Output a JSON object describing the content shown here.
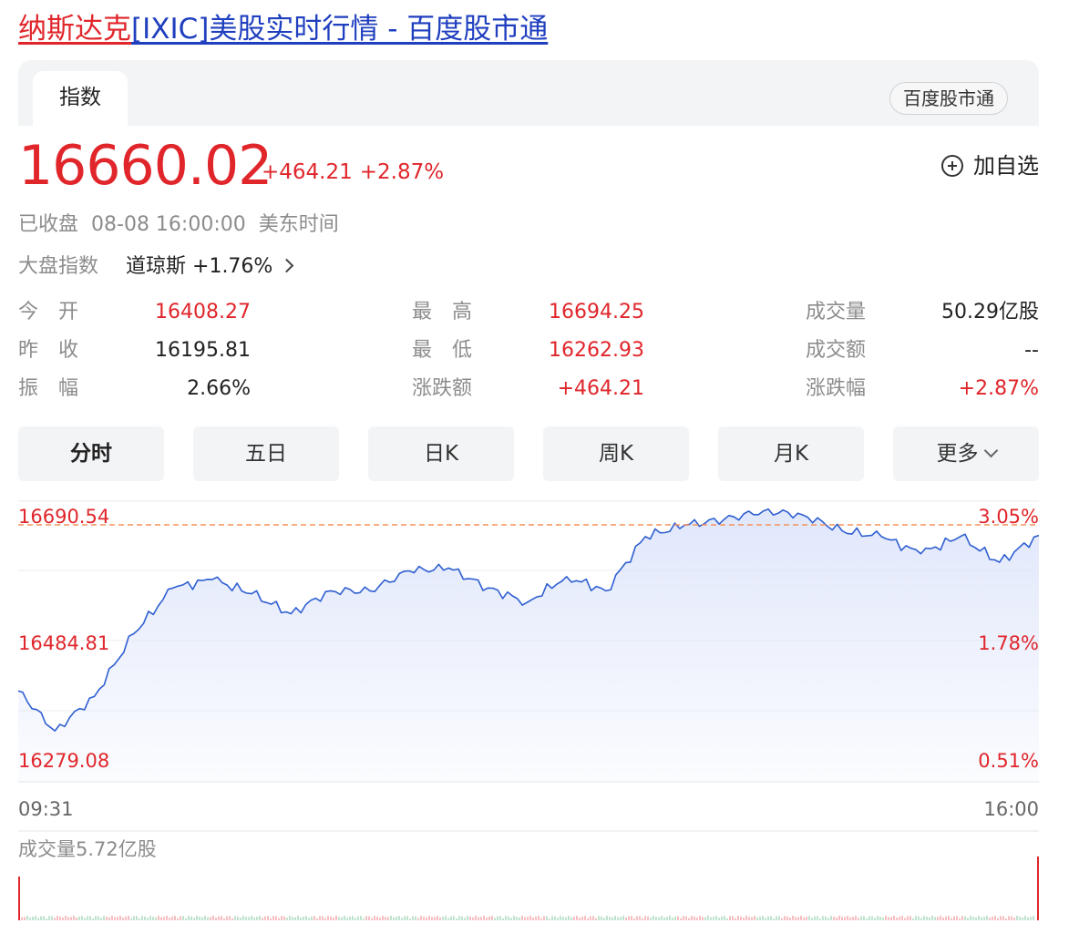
{
  "page_link": {
    "name_part": "纳斯达克",
    "rest_part": "[IXIC]美股实时行情 - 百度股市通"
  },
  "tabs": {
    "active": "指数",
    "source": "百度股市通"
  },
  "quote": {
    "price": "16660.02",
    "change": "+464.21",
    "change_pct": "+2.87%",
    "watchlist_label": "加自选"
  },
  "status": {
    "state": "已收盘",
    "time": "08-08 16:00:00",
    "timezone": "美东时间"
  },
  "market_index": {
    "label": "大盘指数",
    "value": "道琼斯 +1.76%"
  },
  "stats": [
    [
      {
        "label": "今　开",
        "value": "16408.27",
        "color": "#e0262b"
      },
      {
        "label": "最　高",
        "value": "16694.25",
        "color": "#e0262b"
      },
      {
        "label": "成交量",
        "value": "50.29亿股",
        "color": "#222222"
      }
    ],
    [
      {
        "label": "昨　收",
        "value": "16195.81",
        "color": "#222222"
      },
      {
        "label": "最　低",
        "value": "16262.93",
        "color": "#e0262b"
      },
      {
        "label": "成交额",
        "value": "--",
        "color": "#222222"
      }
    ],
    [
      {
        "label": "振　幅",
        "value": "2.66%",
        "color": "#222222"
      },
      {
        "label": "涨跌额",
        "value": "+464.21",
        "color": "#e0262b"
      },
      {
        "label": "涨跌幅",
        "value": "+2.87%",
        "color": "#e0262b"
      }
    ]
  ],
  "periods": [
    "分时",
    "五日",
    "日K",
    "周K",
    "月K",
    "更多"
  ],
  "active_period": "分时",
  "chart_data": {
    "type": "area",
    "y_labels_left": [
      "16690.54",
      "16484.81",
      "16279.08"
    ],
    "y_labels_right": [
      "3.05%",
      "1.78%",
      "0.51%"
    ],
    "x_labels": [
      "09:31",
      "16:00"
    ],
    "x_start": "09:31",
    "x_end": "16:00",
    "ylim": [
      16279.08,
      16690.54
    ],
    "reference_line": 16690.54,
    "x": [
      "09:31",
      "09:45",
      "10:00",
      "10:15",
      "10:30",
      "10:45",
      "11:00",
      "11:15",
      "11:30",
      "11:45",
      "12:00",
      "12:15",
      "12:30",
      "12:45",
      "13:00",
      "13:15",
      "13:30",
      "13:45",
      "14:00",
      "14:15",
      "14:30",
      "14:45",
      "15:00",
      "15:15",
      "15:30",
      "15:45",
      "16:00"
    ],
    "values": [
      16400,
      16330,
      16390,
      16500,
      16580,
      16595,
      16570,
      16535,
      16575,
      16575,
      16610,
      16615,
      16580,
      16555,
      16600,
      16575,
      16670,
      16690,
      16700,
      16715,
      16708,
      16680,
      16670,
      16640,
      16670,
      16625,
      16672
    ],
    "colors": {
      "line": "#2f5fd0",
      "fill": "#dfe6fb",
      "reference": "#f5915a",
      "label": "#e0262b"
    },
    "volume_label": "成交量5.72亿股"
  }
}
